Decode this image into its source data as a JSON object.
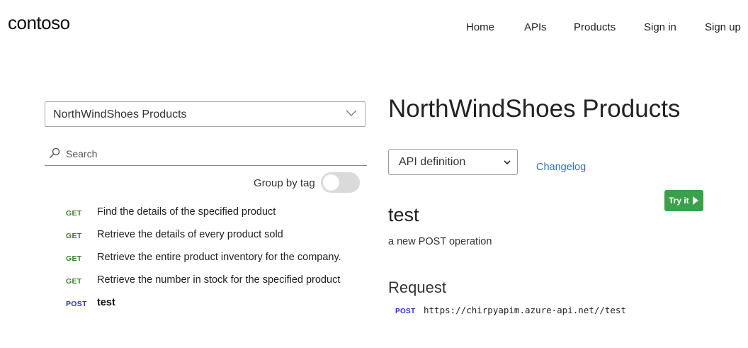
{
  "header": {
    "logo": "contoso",
    "nav": [
      "Home",
      "APIs",
      "Products",
      "Sign in",
      "Sign up"
    ]
  },
  "sidebar": {
    "api_select_value": "NorthWindShoes Products",
    "search_placeholder": "Search",
    "group_by_tag_label": "Group by tag",
    "group_by_tag_on": false,
    "operations": [
      {
        "method": "GET",
        "name": "Find the details of the specified product"
      },
      {
        "method": "GET",
        "name": "Retrieve the details of every product sold"
      },
      {
        "method": "GET",
        "name": "Retrieve the entire product inventory for the company."
      },
      {
        "method": "GET",
        "name": "Retrieve the number in stock for the specified product"
      },
      {
        "method": "POST",
        "name": "test"
      }
    ]
  },
  "main": {
    "api_title": "NorthWindShoes Products",
    "definition_select_value": "API definition",
    "changelog_label": "Changelog",
    "try_it_label": "Try it",
    "operation_title": "test",
    "operation_description": "a new POST operation",
    "request_heading": "Request",
    "request_method": "POST",
    "request_url": "https://chirpyapim.azure-api.net//test"
  },
  "colors": {
    "get_method": "#3a7a2f",
    "post_method": "#2b2bd0",
    "try_it_button": "#3aa14a",
    "link": "#2f6fb7"
  }
}
